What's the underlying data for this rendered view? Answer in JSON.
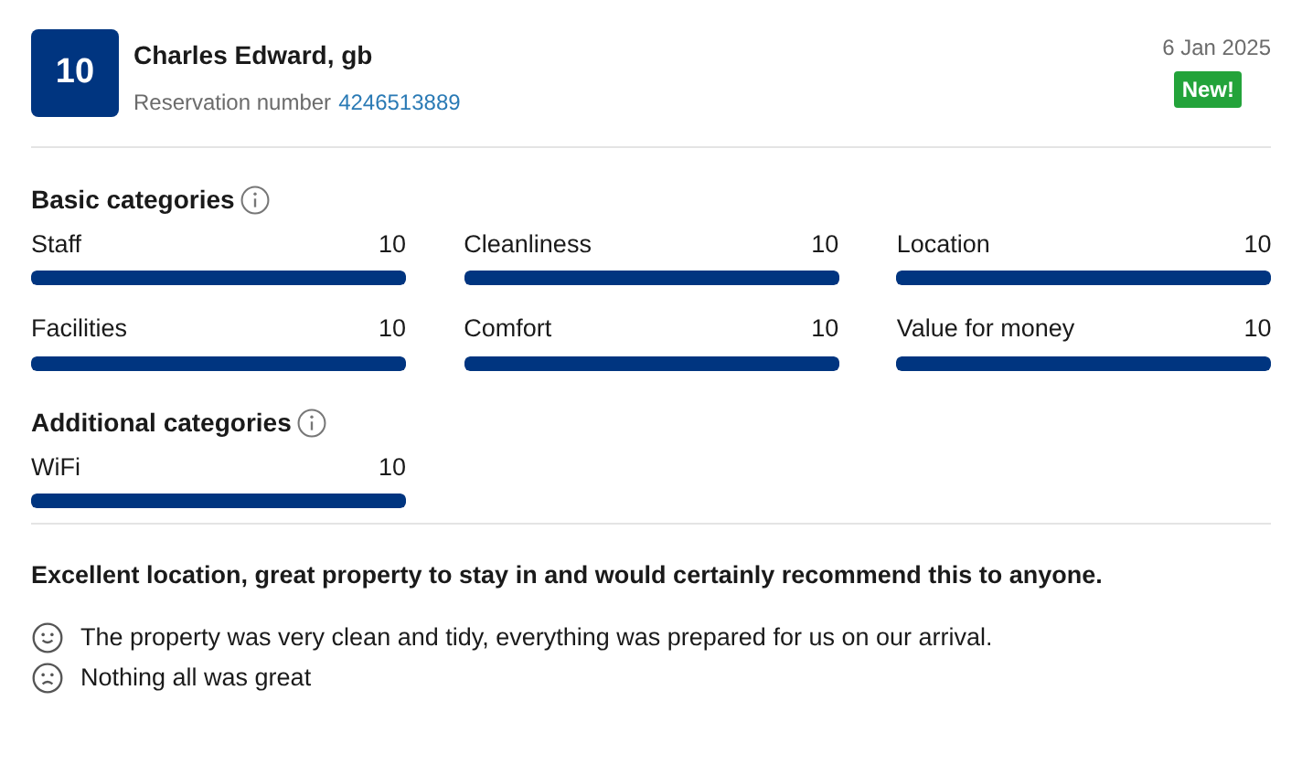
{
  "header": {
    "score": "10",
    "name": "Charles Edward, gb",
    "reservation_label": "Reservation number",
    "reservation_number": "4246513889",
    "date": "6 Jan 2025",
    "badge": "New!"
  },
  "sections": [
    {
      "title": "Basic categories",
      "items": [
        {
          "label": "Staff",
          "score": "10",
          "level": 1
        },
        {
          "label": "Cleanliness",
          "score": "10",
          "level": 1
        },
        {
          "label": "Location",
          "score": "10",
          "level": 1
        },
        {
          "label": "Facilities",
          "score": "10",
          "level": 1
        },
        {
          "label": "Comfort",
          "score": "10",
          "level": 1
        },
        {
          "label": "Value for money",
          "score": "10",
          "level": 1
        }
      ]
    },
    {
      "title": "Additional categories",
      "items": [
        {
          "label": "WiFi",
          "score": "10",
          "level": 1
        }
      ]
    }
  ],
  "review": {
    "title": "Excellent location, great property to stay in and would certainly recommend this to anyone.",
    "comments": [
      {
        "kind": "positive",
        "text": "The property was very clean and tidy, everything was prepared for us on our arrival."
      },
      {
        "kind": "negative",
        "text": "Nothing all was great"
      }
    ]
  }
}
